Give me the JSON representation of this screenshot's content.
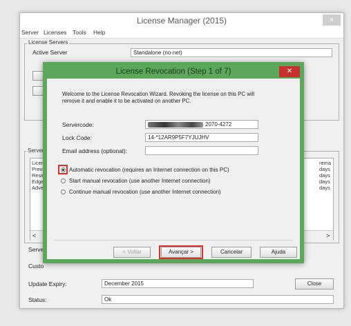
{
  "window": {
    "title": "License Manager (2015)",
    "close_label": "×",
    "menu": [
      "Server",
      "Licenses",
      "Tools",
      "Help"
    ]
  },
  "license_servers": {
    "group_label": "License Servers",
    "active_server_label": "Active Server",
    "active_server_value": "Standalone (no-net)"
  },
  "background": {
    "server_group_label": "Server",
    "list_left": [
      "Licen",
      "Previ",
      "Rese",
      "Edge",
      "Adve"
    ],
    "list_right": [
      "rema",
      "days",
      "days",
      "days",
      "days"
    ],
    "scroll_left": "<",
    "scroll_right": ">",
    "server_label": "Server",
    "custom_label": "Custo",
    "update_expiry_label": "Update Expiry:",
    "update_expiry_value": "December 2015",
    "status_label": "Status:",
    "status_value": "Ok",
    "close_button": "Close"
  },
  "dialog": {
    "title": "License Revocation (Step 1 of 7)",
    "close_label": "✕",
    "intro": "Welcome to the License Revocation Wizard. Revoking the license on this PC will remove it and enable it to be activated on another PC.",
    "servercode_label": "Servercode:",
    "servercode_value": "2070-4272",
    "lockcode_label": "Lock Code:",
    "lockcode_value": "14-*12AR9P5F7YJUJHV",
    "email_label": "Email address (optional):",
    "email_value": "",
    "options": [
      "Automatic revocation (requires an Internet connection on this PC)",
      "Start manual revocation (use another Internet connection)",
      "Continue manual revocation (use another Internet connection)"
    ],
    "buttons": {
      "back": "< Voltar",
      "next": "Avançar >",
      "cancel": "Cancelar",
      "help": "Ajuda"
    }
  },
  "colors": {
    "dialog_frame": "#5ca75c",
    "dialog_close": "#c7302c",
    "highlight": "#d9302c"
  }
}
